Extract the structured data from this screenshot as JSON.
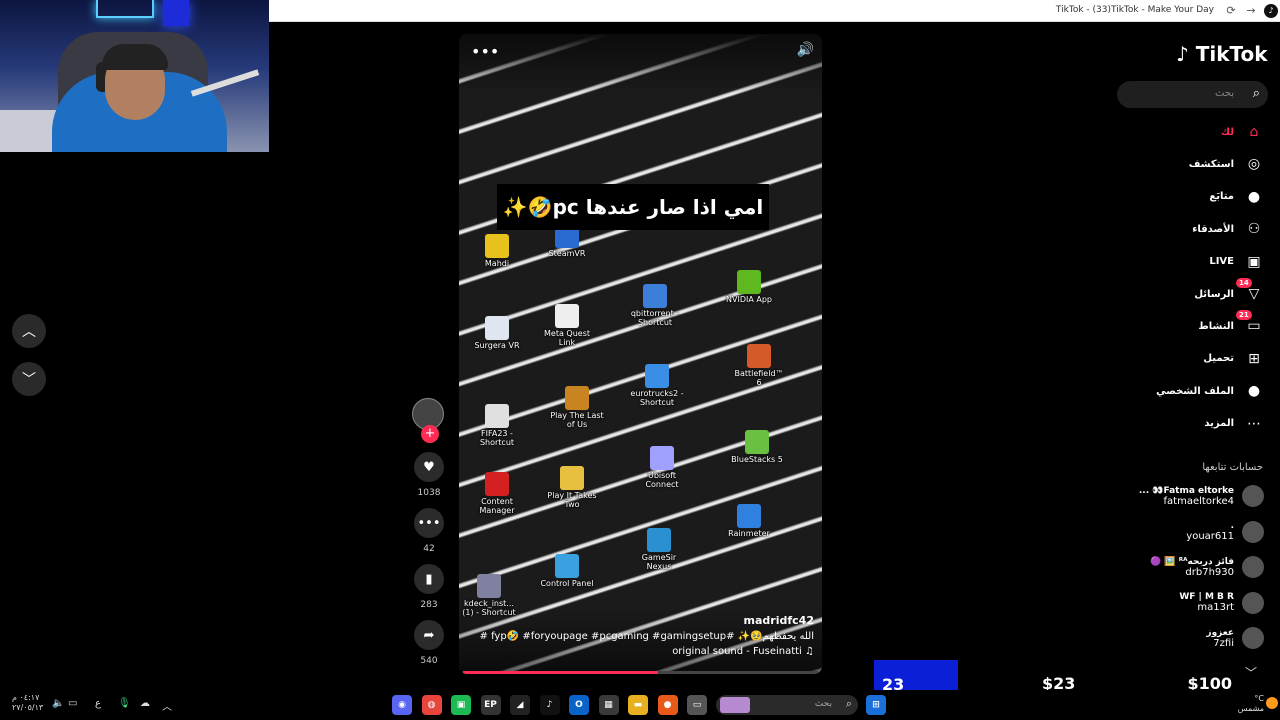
{
  "browser": {
    "window_title": "TikTok - (33)TikTok - Make Your Day",
    "refresh_icon": "refresh-icon",
    "forward_icon": "forward-icon"
  },
  "nav": {
    "up_icon": "chevron-up-icon",
    "down_icon": "chevron-down-icon"
  },
  "video": {
    "caption": "امي اذا صار عندها pc🤣✨",
    "desktop_icons": [
      {
        "label": "Mahdi",
        "color": "#e8c21c"
      },
      {
        "label": "SteamVR",
        "color": "#2a6bd1"
      },
      {
        "label": "NVIDIA App",
        "color": "#5fb81f"
      },
      {
        "label": "qbittorrent - Shortcut",
        "color": "#3b7fd8"
      },
      {
        "label": "Meta Quest Link",
        "color": "#eeeeee"
      },
      {
        "label": "Surgera VR",
        "color": "#dfe6f0"
      },
      {
        "label": "Battlefield™ 6",
        "color": "#d45a2a"
      },
      {
        "label": "eurotrucks2 - Shortcut",
        "color": "#3a8ee6"
      },
      {
        "label": "FIFA23 - Shortcut",
        "color": "#e0e0e0"
      },
      {
        "label": "Play The Last of Us",
        "color": "#c88420"
      },
      {
        "label": "BlueStacks 5",
        "color": "#6ac040"
      },
      {
        "label": "Ubisoft Connect",
        "color": "#a0a0ff"
      },
      {
        "label": "Content Manager",
        "color": "#d42020"
      },
      {
        "label": "Play It Takes Two",
        "color": "#e8c040"
      },
      {
        "label": "Rainmeter",
        "color": "#3080e0"
      },
      {
        "label": "GameSir Nexus",
        "color": "#2a90d0"
      },
      {
        "label": "Control Panel",
        "color": "#3aa0e0"
      },
      {
        "label": "kdeck_inst... (1) - Shortcut",
        "color": "#8080a0"
      }
    ],
    "author": "madridfc42",
    "description": "الله يحفظهم🥹✨ #fyp🤣 #foryoupage #pcgaming #gamingsetup #",
    "sound": "♫ original sound - Fuseinatti",
    "progress": 0.55
  },
  "actions": {
    "follow_label": "+",
    "likes": "1038",
    "comments": "42",
    "saves": "283",
    "shares": "540"
  },
  "sidebar": {
    "logo_text": "TikTok",
    "search_placeholder": "بحث",
    "items": [
      {
        "label": "لك",
        "icon": "home-icon",
        "glyph": "⌂",
        "active": true
      },
      {
        "label": "استكشف",
        "icon": "compass-icon",
        "glyph": "◎"
      },
      {
        "label": "متابَع",
        "icon": "following-avatar-icon",
        "glyph": "●"
      },
      {
        "label": "الأصدقاء",
        "icon": "friends-icon",
        "glyph": "⚇"
      },
      {
        "label": "LIVE",
        "icon": "live-icon",
        "glyph": "▣"
      },
      {
        "label": "الرسائل",
        "icon": "messages-icon",
        "glyph": "▽",
        "badge": "14"
      },
      {
        "label": "النشاط",
        "icon": "activity-icon",
        "glyph": "▭",
        "badge": "21"
      },
      {
        "label": "تحميل",
        "icon": "upload-icon",
        "glyph": "⊞"
      },
      {
        "label": "الملف الشخصي",
        "icon": "profile-icon",
        "glyph": "●"
      },
      {
        "label": "المزيد",
        "icon": "more-icon",
        "glyph": "⋯"
      }
    ],
    "following_title": "حسابات تتابعها",
    "accounts": [
      {
        "name": "... 👀Fatma eltorke",
        "handle": "fatmaeltorke4"
      },
      {
        "name": ".",
        "handle": "youar611"
      },
      {
        "name": "🟣 🖼️ ᴿᴬفائز دربحه",
        "handle": "drb7h930"
      },
      {
        "name": "WF | M B R",
        "handle": "ma13rt"
      },
      {
        "name": "ععزوز",
        "handle": "7zfii"
      }
    ]
  },
  "overlay": {
    "box_value": "23",
    "value_1": "$23",
    "value_2": "$100"
  },
  "taskbar": {
    "time": "٠٤:١٧ م",
    "date": "٢٧/٠٥/١٣",
    "lang": "ع",
    "search_placeholder": "بحث",
    "weather_line1": "°C",
    "weather_line2": "مشمس",
    "apps": [
      {
        "name": "discord-icon",
        "glyph": "◉",
        "color": "#5865f2"
      },
      {
        "name": "chrome-icon",
        "glyph": "◍",
        "color": "#e8453c"
      },
      {
        "name": "app-green-icon",
        "glyph": "▣",
        "color": "#1db954"
      },
      {
        "name": "epic-icon",
        "glyph": "EP",
        "color": "#333333"
      },
      {
        "name": "ea-icon",
        "glyph": "◢",
        "color": "#222222"
      },
      {
        "name": "tiktok-icon",
        "glyph": "♪",
        "color": "#111111"
      },
      {
        "name": "outlook-icon",
        "glyph": "O",
        "color": "#0a64c8"
      },
      {
        "name": "store-icon",
        "glyph": "▦",
        "color": "#3a3a3a"
      },
      {
        "name": "folder-icon",
        "glyph": "▬",
        "color": "#e8b020"
      },
      {
        "name": "orange-app-icon",
        "glyph": "●",
        "color": "#e85a1a"
      },
      {
        "name": "window-icon",
        "glyph": "▭",
        "color": "#555555"
      }
    ]
  }
}
